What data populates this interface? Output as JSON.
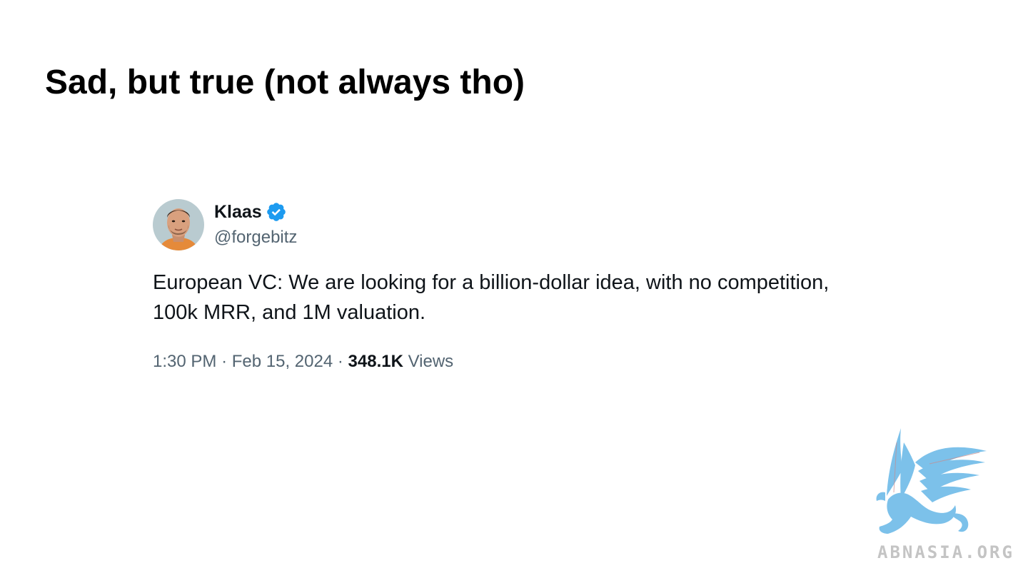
{
  "slide": {
    "title": "Sad, but true (not always tho)"
  },
  "tweet": {
    "author_name": "Klaas",
    "author_handle": "@forgebitz",
    "verified_icon": "verified-badge-icon",
    "text_lines": [
      "European VC: We are looking for a billion-dollar idea, with no competition,",
      "100k MRR, and 1M valuation."
    ],
    "time": "1:30 PM",
    "separator": "·",
    "date": "Feb 15, 2024",
    "views_count": "348.1K",
    "views_label": "Views"
  },
  "watermark": {
    "text": "ABNASIA.ORG",
    "logo_icon": "griffin-logo-icon"
  },
  "colors": {
    "text_primary": "#0f1419",
    "text_secondary": "#536471",
    "verified_blue": "#1d9bf0",
    "logo_blue": "#7cc1ea",
    "watermark_gray": "#c4c4c4"
  }
}
